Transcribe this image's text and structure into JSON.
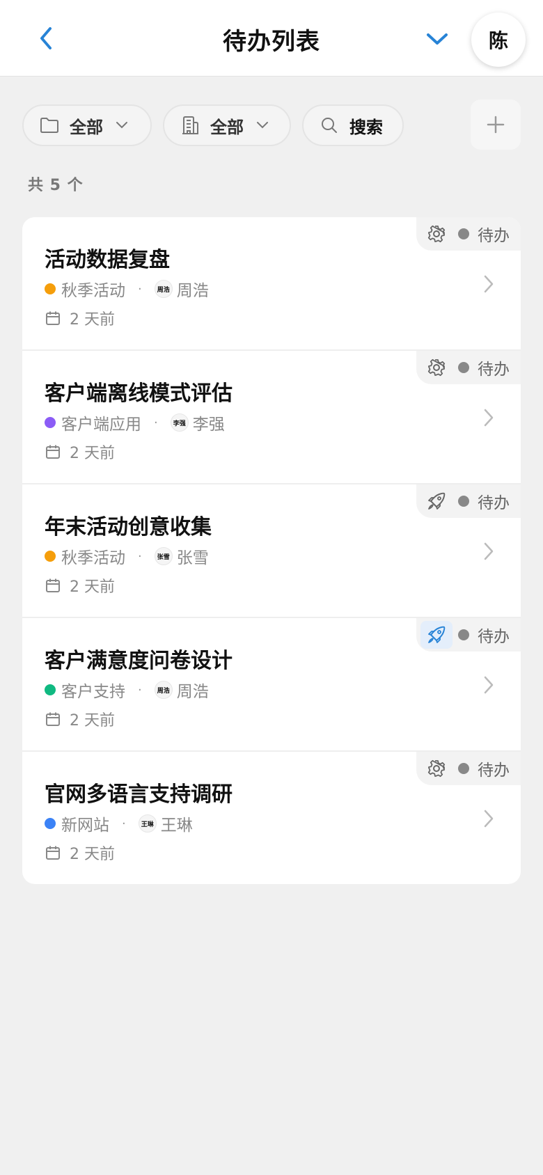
{
  "header": {
    "title": "待办列表",
    "avatar_initial": "陈"
  },
  "filters": {
    "folder_label": "全部",
    "org_label": "全部",
    "search_label": "搜索"
  },
  "count_text": "共 5 个",
  "colors": {
    "accent": "#2783d6",
    "status_gray": "#8c8c8c"
  },
  "tasks": [
    {
      "title": "活动数据复盘",
      "project": "秋季活动",
      "project_color": "#f59e0b",
      "assignee": "周浩",
      "assignee_avatar": "周浩",
      "date": "2 天前",
      "status": "待办",
      "type_icon": "gear-icon"
    },
    {
      "title": "客户端离线模式评估",
      "project": "客户端应用",
      "project_color": "#8b5cf6",
      "assignee": "李强",
      "assignee_avatar": "李强",
      "date": "2 天前",
      "status": "待办",
      "type_icon": "gear-icon"
    },
    {
      "title": "年末活动创意收集",
      "project": "秋季活动",
      "project_color": "#f59e0b",
      "assignee": "张雪",
      "assignee_avatar": "张雪",
      "date": "2 天前",
      "status": "待办",
      "type_icon": "rocket-icon"
    },
    {
      "title": "客户满意度问卷设计",
      "project": "客户支持",
      "project_color": "#10b981",
      "assignee": "周浩",
      "assignee_avatar": "周浩",
      "date": "2 天前",
      "status": "待办",
      "type_icon": "rocket-icon"
    },
    {
      "title": "官网多语言支持调研",
      "project": "新网站",
      "project_color": "#3b82f6",
      "assignee": "王琳",
      "assignee_avatar": "王琳",
      "date": "2 天前",
      "status": "待办",
      "type_icon": "gear-icon"
    }
  ]
}
